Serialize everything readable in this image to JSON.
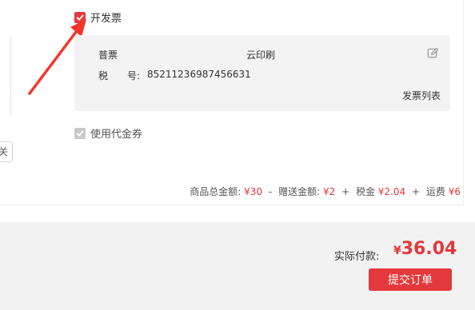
{
  "invoice": {
    "toggle_label": "开发票",
    "type": "普票",
    "company": "云印刷",
    "tax_label": "税　　号:",
    "tax_number": "85211236987456631",
    "list_link": "发票列表"
  },
  "voucher": {
    "toggle_label": "使用代金券"
  },
  "left_button": {
    "label": "关"
  },
  "summary": {
    "goods_label": "商品总金额:",
    "goods_amount": "¥30",
    "minus": "-",
    "gift_label": "赠送金额:",
    "gift_amount": "¥2",
    "plus1": "+",
    "tax_label": "税金",
    "tax_amount": "¥2.04",
    "plus2": "+",
    "shipping_label": "运费",
    "shipping_amount": "¥6"
  },
  "payment": {
    "label": "实际付款:",
    "currency": "¥",
    "amount": "36.04",
    "submit_label": "提交订单"
  },
  "colors": {
    "accent": "#e4393c",
    "annotation_arrow": "#f5352b"
  }
}
